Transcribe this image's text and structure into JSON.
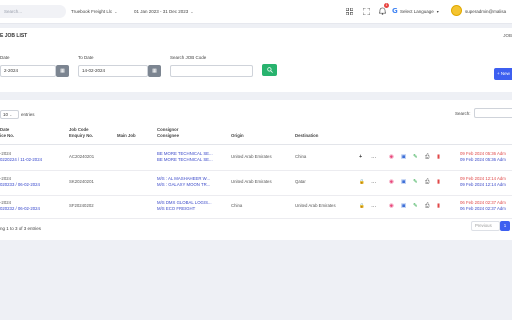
{
  "topbar": {
    "search_placeholder": "Search...",
    "company": "Truebook Freight Llc",
    "period": "01 Jan 2023 - 31 Dec 2023",
    "notification_count": "1",
    "language_label": "Select Language",
    "user": "superadmin@malisa"
  },
  "header": {
    "title": "E JOB LIST",
    "breadcrumb": "JOB",
    "from_label": "Date",
    "from_value": "2-2024",
    "to_label": "To Date",
    "to_value": "14-02-2024",
    "search_label": "Search JOB Code",
    "add_label": "+ New"
  },
  "table": {
    "entries_value": "10",
    "entries_label": "entries",
    "search_label": "Search:",
    "columns": [
      {
        "l1": "Date",
        "l2": "ice No."
      },
      {
        "l1": "Job Code",
        "l2": "Enquiry No."
      },
      {
        "l1": "Main Job",
        "l2": ""
      },
      {
        "l1": "Consignor",
        "l2": "Consignee"
      },
      {
        "l1": "Origin",
        "l2": ""
      },
      {
        "l1": "Destination",
        "l2": ""
      }
    ],
    "rows": [
      {
        "date": "-2024",
        "invoice": "0220224 / 11-02-2024",
        "job_code": "AC20240201",
        "consignor": "BE MORE TECHNICAL SE...",
        "consignee": "BE MORE TECHNICAL SE...",
        "origin": "United Arab Emirates",
        "destination": "China",
        "created": "09 Feb 2024 05:36 Adm",
        "updated": "09 Feb 2024 05:36 Adm",
        "lock": "+"
      },
      {
        "date": "-2024",
        "invoice": "020233 / 06-02-2024",
        "job_code": "SK20240201",
        "consignor": "M/S : AL MASHAHEER W...",
        "consignee": "M/S : GALAXY MOON TR...",
        "origin": "United Arab Emirates",
        "destination": "Qatar",
        "created": "09 Feb 2024 12:14 Adm",
        "updated": "09 Feb 2024 12:14 Adm",
        "lock": "🔒"
      },
      {
        "date": "-2024",
        "invoice": "020232 / 06-02-2024",
        "job_code": "SF20240202",
        "consignor": "M/S DMX GLOBAL LOGIS...",
        "consignee": "M/S ECO FREIGHT",
        "origin": "China",
        "destination": "United Arab Emirates",
        "created": "06 Feb 2024 02:37 Adm",
        "updated": "06 Feb 2024 02:37 Adm",
        "lock": "🔒"
      }
    ],
    "info": "ng 1 to 3 of 3 entries",
    "prev_label": "Previous",
    "page": "1"
  },
  "colors": {
    "primary": "#3d5ff0",
    "success": "#28b36e",
    "danger": "#e04848"
  }
}
